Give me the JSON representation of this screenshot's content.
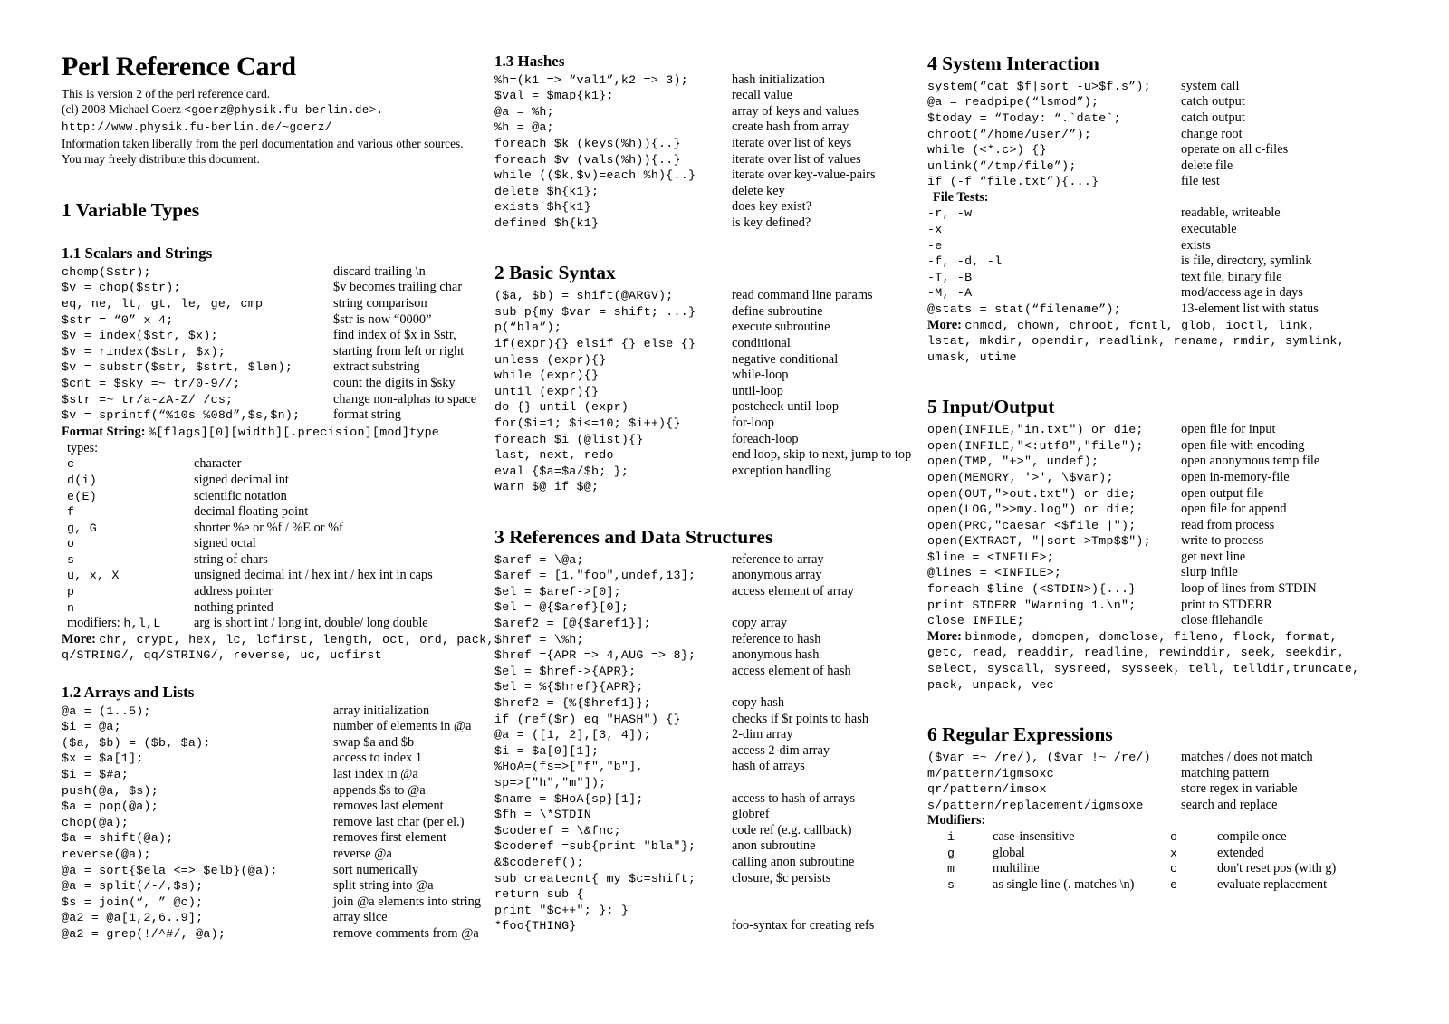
{
  "document": {
    "title": "Perl Reference Card",
    "subtitle_lines": [
      "This is version  2 of the perl reference card.",
      "(cl) 2008 Michael Goerz <goerz@physik.fu-berlin.de>.",
      "http://www.physik.fu-berlin.de/~goerz/",
      "Information taken liberally from the perl documentation and various other sources.",
      "You may freely distribute this document."
    ],
    "subtitle_1": "This is version  2 of the perl reference card.",
    "subtitle_2_pre": "(cl) 2008 Michael Goerz ",
    "subtitle_2_mono": "<goerz@physik.fu-berlin.de>.",
    "subtitle_3_mono": "http://www.physik.fu-berlin.de/~goerz/",
    "subtitle_4": "Information taken liberally from the perl documentation and various other sources.",
    "subtitle_5": "You may freely distribute this document."
  },
  "sections": {
    "variable_types": {
      "heading": "1 Variable Types",
      "scalars": {
        "heading": "1.1 Scalars and Strings",
        "rows": [
          {
            "code": "chomp($str);",
            "desc": "discard trailing \\n"
          },
          {
            "code": "$v = chop($str);",
            "desc": "$v becomes trailing char"
          },
          {
            "code": "eq, ne, lt, gt, le, ge, cmp",
            "desc": "string comparison"
          },
          {
            "code": "$str = “0” x 4;",
            "desc": "$str is now “0000”"
          },
          {
            "code": "$v = index($str, $x);",
            "desc": "find index of $x in $str,"
          },
          {
            "code": "$v = rindex($str, $x);",
            "desc": "starting from left or right"
          },
          {
            "code": "$v = substr($str, $strt, $len);",
            "desc": "extract substring"
          },
          {
            "code": "$cnt = $sky =~ tr/0-9//;",
            "desc": "count the digits in $sky"
          },
          {
            "code": "$str =~ tr/a-zA-Z/ /cs;",
            "desc": "change non-alphas to space"
          },
          {
            "code": "$v = sprintf(“%10s %08d”,$s,$n);",
            "desc": "format string"
          }
        ],
        "format_string_label": "Format String:",
        "format_string_value": "%[flags][0][width][.precision][mod]type",
        "types_label": "types:",
        "types": [
          {
            "t": "c",
            "d": "character"
          },
          {
            "t": "d(i)",
            "d": "signed decimal int"
          },
          {
            "t": "e(E)",
            "d": "scientific notation"
          },
          {
            "t": "f",
            "d": "decimal floating point"
          },
          {
            "t": "g, G",
            "d": "shorter %e or %f  /  %E or %f"
          },
          {
            "t": "o",
            "d": "signed octal"
          },
          {
            "t": "s",
            "d": "string of chars"
          },
          {
            "t": "u, x, X",
            "d": "unsigned decimal int / hex int / hex int in caps"
          },
          {
            "t": "p",
            "d": "address pointer"
          },
          {
            "t": "n",
            "d": "nothing printed"
          }
        ],
        "modifiers_label": "modifiers:",
        "modifiers_keys": "h,l,L",
        "modifiers_desc": "arg is short int / long int, double/ long double",
        "more_label": "More:",
        "more_value": "chr, crypt, hex, lc, lcfirst, length, oct, ord, pack, q/STRING/, qq/STRING/, reverse, uc, ucfirst"
      },
      "arrays": {
        "heading": "1.2 Arrays and Lists",
        "rows": [
          {
            "code": "@a = (1..5);",
            "desc": "array initialization"
          },
          {
            "code": "$i = @a;",
            "desc": "number of elements in @a"
          },
          {
            "code": "($a, $b) = ($b, $a);",
            "desc": "swap $a and $b"
          },
          {
            "code": "$x = $a[1];",
            "desc": "access to index 1"
          },
          {
            "code": "$i = $#a;",
            "desc": "last index in @a"
          },
          {
            "code": "push(@a, $s);",
            "desc": "appends $s to @a"
          },
          {
            "code": "$a = pop(@a);",
            "desc": "removes last element"
          },
          {
            "code": "chop(@a);",
            "desc": "remove last char (per el.)"
          },
          {
            "code": "$a = shift(@a);",
            "desc": "removes first element"
          },
          {
            "code": "reverse(@a);",
            "desc": "reverse @a"
          },
          {
            "code": "@a = sort{$ela <=> $elb}(@a);",
            "desc": "sort numerically"
          },
          {
            "code": "@a = split(/-/,$s);",
            "desc": "split string into @a"
          },
          {
            "code": "$s = join(“, ” @c);",
            "desc": "join @a elements into string"
          },
          {
            "code": "@a2 = @a[1,2,6..9];",
            "desc": "array slice"
          },
          {
            "code": "@a2 = grep(!/^#/, @a);",
            "desc": "remove comments from @a"
          }
        ]
      },
      "hashes": {
        "heading": "1.3 Hashes",
        "rows": [
          {
            "code": "%h=(k1 => “val1”,k2 => 3);",
            "desc": "hash initialization"
          },
          {
            "code": "$val = $map{k1};",
            "desc": "recall value"
          },
          {
            "code": "@a = %h;",
            "desc": "array of keys and values"
          },
          {
            "code": "%h = @a;",
            "desc": "create hash from array"
          },
          {
            "code": "foreach $k (keys(%h)){..}",
            "desc": "iterate over list of keys"
          },
          {
            "code": "foreach $v (vals(%h)){..}",
            "desc": "iterate over list of values"
          },
          {
            "code": "while (($k,$v)=each %h){..}",
            "desc": "iterate over key-value-pairs"
          },
          {
            "code": "delete $h{k1};",
            "desc": "delete key"
          },
          {
            "code": "exists $h{k1}",
            "desc": "does key exist?"
          },
          {
            "code": "defined $h{k1}",
            "desc": "is key defined?"
          }
        ]
      }
    },
    "basic_syntax": {
      "heading": "2 Basic Syntax",
      "rows": [
        {
          "code": "($a, $b) = shift(@ARGV);",
          "desc": "read command line params"
        },
        {
          "code": "sub p{my $var = shift; ...}",
          "desc": "define subroutine"
        },
        {
          "code": "p(“bla”);",
          "desc": "execute subroutine"
        },
        {
          "code": "if(expr){} elsif {} else {}",
          "desc": "conditional"
        },
        {
          "code": "unless (expr){}",
          "desc": "negative conditional"
        },
        {
          "code": "while (expr){}",
          "desc": "while-loop"
        },
        {
          "code": "until (expr){}",
          "desc": "until-loop"
        },
        {
          "code": "do {} until (expr)",
          "desc": "postcheck until-loop"
        },
        {
          "code": "for($i=1; $i<=10; $i++){}",
          "desc": "for-loop"
        },
        {
          "code": "foreach $i (@list){}",
          "desc": "foreach-loop"
        },
        {
          "code": "last, next, redo",
          "desc": "end loop, skip to next, jump to top"
        },
        {
          "code": "eval {$a=$a/$b; };",
          "desc": "exception handling"
        },
        {
          "code": " warn $@ if $@;",
          "desc": ""
        }
      ]
    },
    "references": {
      "heading": "3 References and Data Structures",
      "rows": [
        {
          "code": "$aref = \\@a;",
          "desc": "reference to array"
        },
        {
          "code": "$aref = [1,\"foo\",undef,13];",
          "desc": "anonymous array"
        },
        {
          "code": "$el = $aref->[0];",
          "desc": "access element of array"
        },
        {
          "code": "$el = @{$aref}[0];",
          "desc": ""
        },
        {
          "code": "$aref2 = [@{$aref1}];",
          "desc": "copy array"
        },
        {
          "code": "$href = \\%h;",
          "desc": "reference to hash"
        },
        {
          "code": "$href ={APR => 4,AUG => 8};",
          "desc": "anonymous hash"
        },
        {
          "code": "$el = $href->{APR};",
          "desc": "access element of hash"
        },
        {
          "code": "$el = %{$href}{APR};",
          "desc": ""
        },
        {
          "code": "$href2 = {%{$href1}};",
          "desc": "copy hash"
        },
        {
          "code": "if (ref($r) eq \"HASH\") {}",
          "desc": "checks if $r points to hash"
        },
        {
          "code": "@a = ([1, 2],[3, 4]);",
          "desc": "2-dim array"
        },
        {
          "code": "$i = $a[0][1];",
          "desc": "access 2-dim array"
        },
        {
          "code": "%HoA=(fs=>[\"f\",\"b\"],",
          "desc": "hash of arrays"
        },
        {
          "code": "       sp=>[\"h\",\"m\"]);",
          "desc": ""
        },
        {
          "code": "$name = $HoA{sp}[1];",
          "desc": "access to hash of arrays"
        },
        {
          "code": "$fh = \\*STDIN",
          "desc": "globref"
        },
        {
          "code": "$coderef = \\&fnc;",
          "desc": "code ref (e.g. callback)"
        },
        {
          "code": "$coderef =sub{print \"bla\"};",
          "desc": "anon subroutine"
        },
        {
          "code": "&$coderef();",
          "desc": "calling anon subroutine"
        },
        {
          "code": "sub createcnt{ my $c=shift;",
          "desc": "closure, $c  persists"
        },
        {
          "code": "    return sub {",
          "desc": ""
        },
        {
          "code": "        print \"$c++\"; }; }",
          "desc": ""
        },
        {
          "code": "*foo{THING}",
          "desc": "foo-syntax for creating refs"
        }
      ]
    },
    "system_interaction": {
      "heading": "4 System Interaction",
      "rows": [
        {
          "code": "system(“cat $f|sort -u>$f.s”);",
          "desc": "system call"
        },
        {
          "code": "@a = readpipe(“lsmod”);",
          "desc": "catch output"
        },
        {
          "code": "$today = “Today: “.`date`;",
          "desc": "catch output"
        },
        {
          "code": "chroot(“/home/user/”);",
          "desc": "change root"
        },
        {
          "code": "while (<*.c>) {}",
          "desc": "operate on all c-files"
        },
        {
          "code": "unlink(“/tmp/file”);",
          "desc": "delete file"
        },
        {
          "code": "if (-f “file.txt”){...}",
          "desc": "file test"
        }
      ],
      "file_tests_label": "File Tests:",
      "file_tests": [
        {
          "code": "-r, -w",
          "desc": "readable, writeable"
        },
        {
          "code": "-x",
          "desc": "executable"
        },
        {
          "code": "-e",
          "desc": "exists"
        },
        {
          "code": "-f, -d, -l",
          "desc": "is file, directory, symlink"
        },
        {
          "code": "-T, -B",
          "desc": "text file, binary file"
        },
        {
          "code": "-M, -A",
          "desc": "mod/access age in days"
        },
        {
          "code": "@stats = stat(“filename”);",
          "desc": "13-element list with status"
        }
      ],
      "more_label": "More:",
      "more_value": "chmod, chown, chroot, fcntl, glob, ioctl, link, lstat, mkdir, opendir, readlink, rename, rmdir, symlink, umask, utime"
    },
    "input_output": {
      "heading": "5 Input/Output",
      "rows": [
        {
          "code": "open(INFILE,\"in.txt\") or die;",
          "desc": "open file for input"
        },
        {
          "code": "open(INFILE,\"<:utf8\",\"file\");",
          "desc": "open file with encoding"
        },
        {
          "code": "open(TMP, \"+>\", undef);",
          "desc": "open anonymous temp file"
        },
        {
          "code": "open(MEMORY, '>', \\$var);",
          "desc": "open in-memory-file"
        },
        {
          "code": "open(OUT,\">out.txt\") or die;",
          "desc": "open output file"
        },
        {
          "code": "open(LOG,\">>my.log\") or die;",
          "desc": "open file for append"
        },
        {
          "code": "open(PRC,\"caesar <$file |\");",
          "desc": "read from process"
        },
        {
          "code": "open(EXTRACT, \"|sort >Tmp$$\");",
          "desc": "write to process"
        },
        {
          "code": "$line  = <INFILE>;",
          "desc": "get next line"
        },
        {
          "code": "@lines  = <INFILE>;",
          "desc": "slurp infile"
        },
        {
          "code": "foreach $line (<STDIN>){...}",
          "desc": "loop of lines from STDIN"
        },
        {
          "code": "print STDERR \"Warning 1.\\n\";",
          "desc": "print to STDERR"
        },
        {
          "code": "close INFILE;",
          "desc": "close filehandle"
        }
      ],
      "more_label": "More:",
      "more_value": "binmode, dbmopen, dbmclose, fileno, flock, format, getc, read, readdir, readline, rewinddir, seek, seekdir, select, syscall, sysreed, sysseek, tell, telldir,truncate, pack, unpack, vec"
    },
    "regex": {
      "heading": "6 Regular Expressions",
      "rows": [
        {
          "code": "($var =~ /re/), ($var !~ /re/)",
          "desc": "matches / does not match"
        },
        {
          "code": "m/pattern/igmsoxc",
          "desc": "matching pattern"
        },
        {
          "code": "qr/pattern/imsox",
          "desc": "store regex in variable"
        },
        {
          "code": "s/pattern/replacement/igmsoxe",
          "desc": "search and replace"
        }
      ],
      "modifiers_label": "Modifiers:",
      "modifiers": [
        {
          "k1": "i",
          "v1": "case-insensitive",
          "k2": "o",
          "v2": "compile once"
        },
        {
          "k1": "g",
          "v1": "global",
          "k2": "x",
          "v2": "extended"
        },
        {
          "k1": "m",
          "v1": "multiline",
          "k2": "c",
          "v2": "don't reset pos (with g)"
        },
        {
          "k1": "s",
          "v1": "as single line (. matches \\n)",
          "k2": "e",
          "v2": "evaluate replacement"
        }
      ]
    }
  }
}
